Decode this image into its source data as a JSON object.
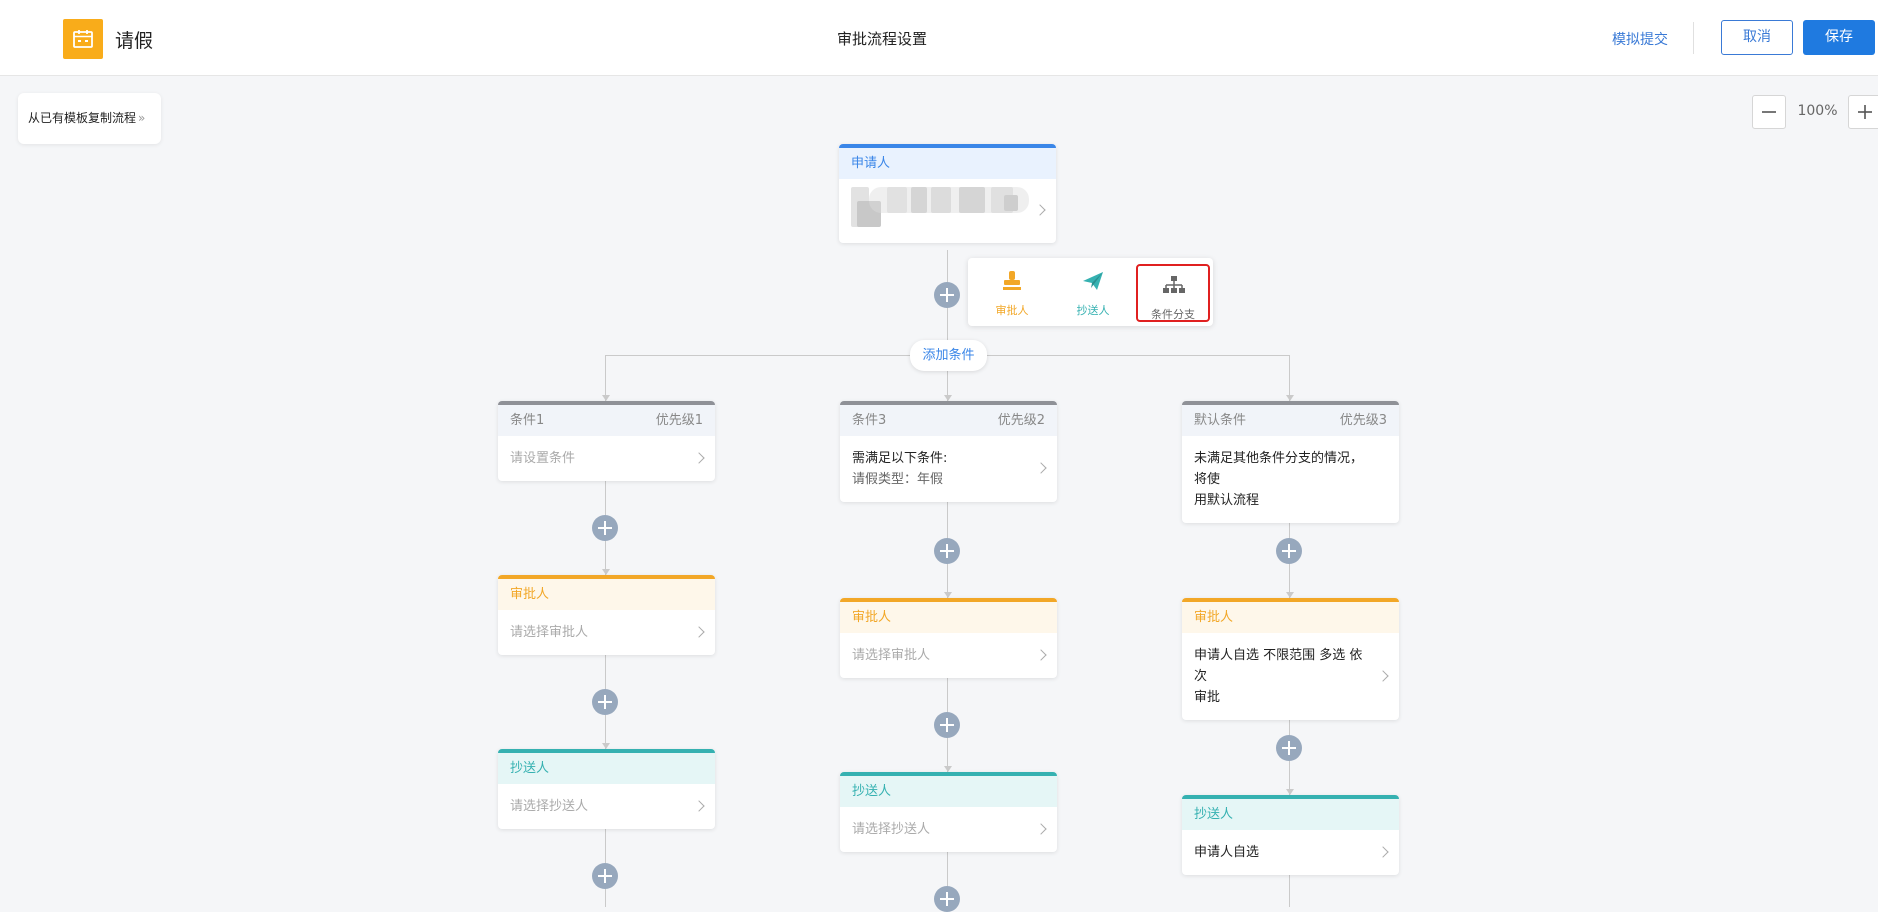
{
  "header": {
    "app_name": "请假",
    "page_title": "审批流程设置",
    "simulate_label": "模拟提交",
    "cancel_label": "取消",
    "save_label": "保存",
    "app_icon": "calendar-icon",
    "accent_color": "#1f7ae0"
  },
  "toolbar": {
    "copy_template_label": "从已有模板复制流程",
    "copy_chevron": "»",
    "zoom_level": "100%"
  },
  "applicant_node": {
    "title": "申请人",
    "content_note": "pixelated / obscured text"
  },
  "add_menu": {
    "options": [
      {
        "label": "审批人",
        "icon": "stamp-icon",
        "color": "#f2a727"
      },
      {
        "label": "抄送人",
        "icon": "paper-plane-icon",
        "color": "#35b1b1"
      },
      {
        "label": "条件分支",
        "icon": "branch-icon",
        "color": "#777777",
        "highlighted": true
      }
    ]
  },
  "add_condition_label": "添加条件",
  "branches": [
    {
      "condition": {
        "title": "条件1",
        "priority": "优先级1",
        "body": [
          "请设置条件"
        ],
        "placeholder": true
      },
      "approver": {
        "title": "审批人",
        "body": [
          "请选择审批人"
        ],
        "placeholder": true
      },
      "cc": {
        "title": "抄送人",
        "body": [
          "请选择抄送人"
        ],
        "placeholder": true
      }
    },
    {
      "condition": {
        "title": "条件3",
        "priority": "优先级2",
        "body": [
          "需满足以下条件:",
          "请假类型：年假"
        ],
        "placeholder": false
      },
      "approver": {
        "title": "审批人",
        "body": [
          "请选择审批人"
        ],
        "placeholder": true
      },
      "cc": {
        "title": "抄送人",
        "body": [
          "请选择抄送人"
        ],
        "placeholder": true
      }
    },
    {
      "condition": {
        "title": "默认条件",
        "priority": "优先级3",
        "body": [
          "未满足其他条件分支的情况，将使",
          "用默认流程"
        ],
        "placeholder": false
      },
      "approver": {
        "title": "审批人",
        "body": [
          "申请人自选 不限范围 多选 依次",
          "审批"
        ],
        "placeholder": false
      },
      "cc": {
        "title": "抄送人",
        "body": [
          "申请人自选"
        ],
        "placeholder": false
      }
    }
  ],
  "colors": {
    "applicant": "#3a86e8",
    "approver": "#f2a727",
    "cc": "#35b1b1",
    "condition": "#8f9197",
    "add_button": "#97a8bd"
  }
}
